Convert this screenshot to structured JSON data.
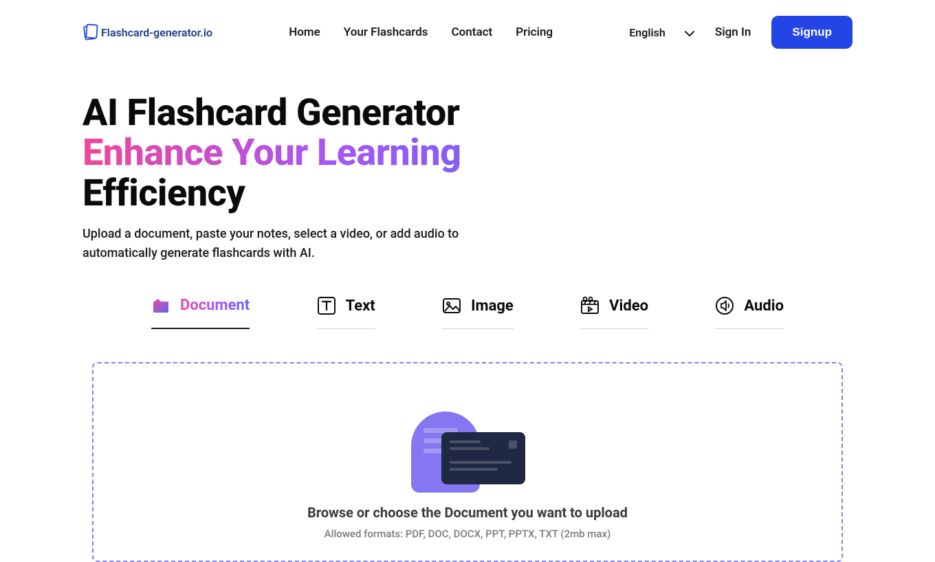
{
  "header": {
    "logo_text": "Flashcard-generator.io",
    "nav": [
      {
        "label": "Home"
      },
      {
        "label": "Your Flashcards"
      },
      {
        "label": "Contact"
      },
      {
        "label": "Pricing"
      }
    ],
    "language": "English",
    "signin": "Sign In",
    "signup": "Signup"
  },
  "hero": {
    "title_line1": "AI Flashcard Generator",
    "title_line2": "Enhance Your Learning",
    "title_line3": "Efficiency",
    "subtitle": "Upload a document, paste your notes, select a video, or add audio to automatically generate flashcards with AI."
  },
  "tabs": [
    {
      "label": "Document",
      "icon": "document-icon",
      "active": true
    },
    {
      "label": "Text",
      "icon": "text-icon",
      "active": false
    },
    {
      "label": "Image",
      "icon": "image-icon",
      "active": false
    },
    {
      "label": "Video",
      "icon": "video-icon",
      "active": false
    },
    {
      "label": "Audio",
      "icon": "audio-icon",
      "active": false
    }
  ],
  "upload": {
    "title": "Browse or choose the Document you want to upload",
    "formats": "Allowed formats: PDF, DOC, DOCX, PPT, PPTX, TXT (2mb max)"
  }
}
